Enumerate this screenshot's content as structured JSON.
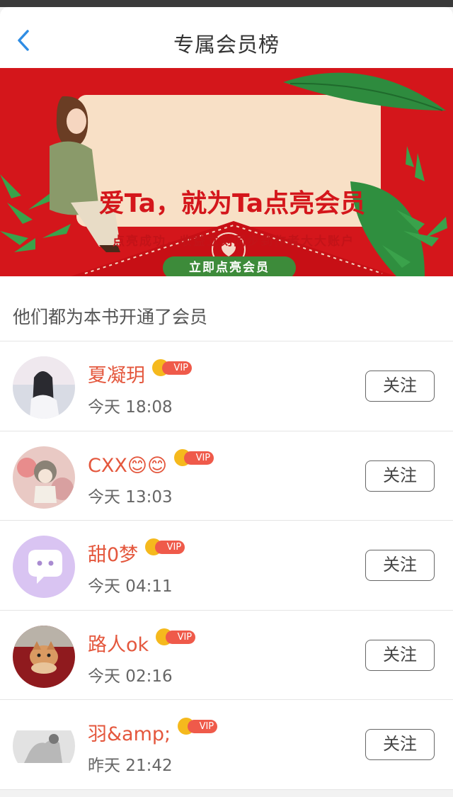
{
  "nav": {
    "title": "专属会员榜",
    "back_icon": "chevron-left-icon"
  },
  "banner": {
    "title": "爱Ta，就为Ta点亮会员",
    "subtitle": "点亮成功，收益立刻同步到作者大大账户",
    "button_label": "立即点亮会员"
  },
  "section": {
    "heading": "他们都为本书开通了会员"
  },
  "members": [
    {
      "name": "夏凝玥",
      "badge": "VIP",
      "time": "今天 18:08",
      "follow_label": "关注"
    },
    {
      "name": "CXX😊😊",
      "badge": "VIP",
      "time": "今天 13:03",
      "follow_label": "关注"
    },
    {
      "name": "甜0梦",
      "badge": "VIP",
      "time": "今天 04:11",
      "follow_label": "关注"
    },
    {
      "name": "路人ok",
      "badge": "VIP",
      "time": "今天 02:16",
      "follow_label": "关注"
    },
    {
      "name": "羽&amp;",
      "badge": "VIP",
      "time": "昨天 21:42",
      "follow_label": "关注"
    }
  ],
  "colors": {
    "accent": "#e4573d",
    "banner_red": "#d4161b",
    "nav_blue": "#2f8de4"
  }
}
